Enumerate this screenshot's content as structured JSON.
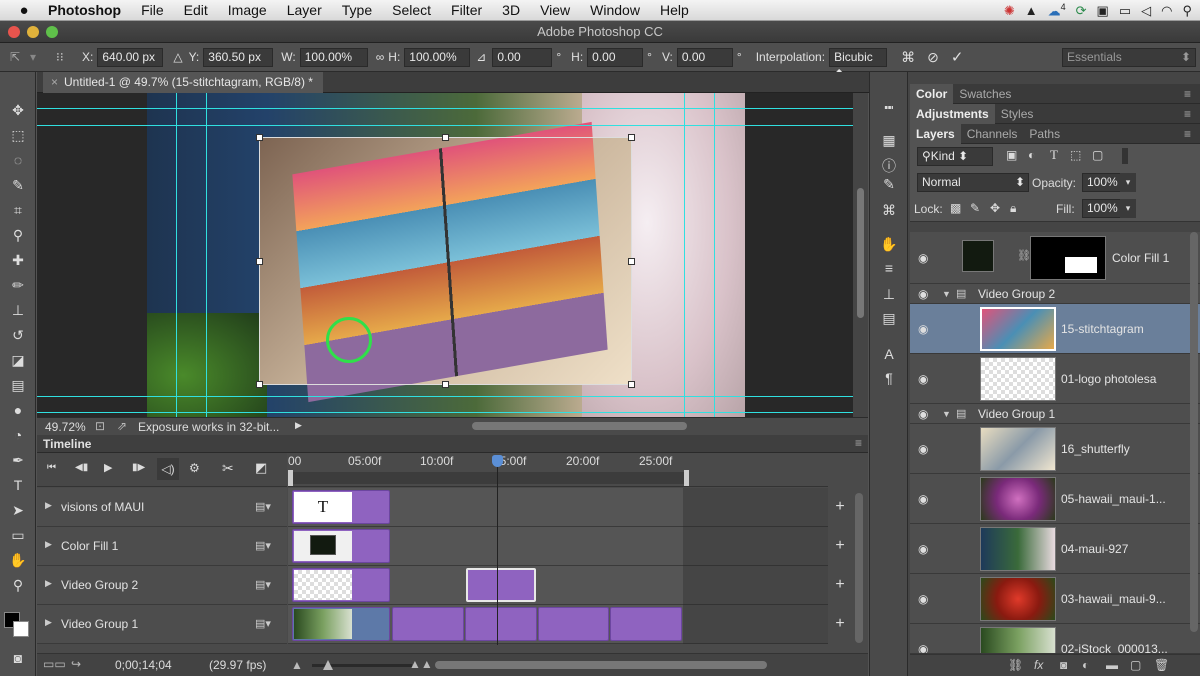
{
  "menubar": {
    "apple_icon": "apple-logo-icon",
    "app": "Photoshop",
    "items": [
      "File",
      "Edit",
      "Image",
      "Layer",
      "Type",
      "Select",
      "Filter",
      "3D",
      "View",
      "Window",
      "Help"
    ],
    "tray_badge": "4"
  },
  "window": {
    "title": "Adobe Photoshop CC"
  },
  "options": {
    "x_label": "X:",
    "x_value": "640.00 px",
    "y_label": "Y:",
    "y_value": "360.50 px",
    "w_label": "W:",
    "w_value": "100.00%",
    "h_label": "H:",
    "h_value": "100.00%",
    "angle_value": "0.00",
    "hskew_label": "H:",
    "hskew_value": "0.00",
    "vskew_label": "V:",
    "vskew_value": "0.00",
    "interp_label": "Interpolation:",
    "interp_value": "Bicubic",
    "degree": "°",
    "workspace": "Essentials"
  },
  "document": {
    "tab_title": "Untitled-1 @ 49.7% (15-stitchtagram, RGB/8) *"
  },
  "status": {
    "zoom": "49.72%",
    "message": "Exposure works in 32-bit..."
  },
  "timeline": {
    "title": "Timeline",
    "ruler": [
      "00",
      "05:00f",
      "10:00f",
      "15:00f",
      "20:00f",
      "25:00f"
    ],
    "tracks": [
      {
        "name": "visions of MAUI"
      },
      {
        "name": "Color Fill 1"
      },
      {
        "name": "Video Group 2"
      },
      {
        "name": "Video Group 1"
      }
    ],
    "timecode": "0;00;14;04",
    "fps": "(29.97 fps)",
    "text_clip_glyph": "T"
  },
  "panels": {
    "tabs_row1": [
      "Color",
      "Swatches"
    ],
    "tabs_row2": [
      "Adjustments",
      "Styles"
    ],
    "tabs_row3": [
      "Layers",
      "Channels",
      "Paths"
    ],
    "kind": "Kind",
    "blend_mode": "Normal",
    "opacity_label": "Opacity:",
    "opacity_value": "100%",
    "lock_label": "Lock:",
    "fill_label": "Fill:",
    "fill_value": "100%",
    "layers": [
      {
        "name": "Color Fill 1",
        "type": "fill"
      },
      {
        "name": "Video Group 2",
        "type": "group"
      },
      {
        "name": "15-stitchtagram",
        "type": "layer",
        "selected": true
      },
      {
        "name": "01-logo photolesa",
        "type": "layer"
      },
      {
        "name": "Video Group 1",
        "type": "group"
      },
      {
        "name": "16_shutterfly",
        "type": "layer"
      },
      {
        "name": "05-hawaii_maui-1...",
        "type": "layer"
      },
      {
        "name": "04-maui-927",
        "type": "layer"
      },
      {
        "name": "03-hawaii_maui-9...",
        "type": "layer"
      },
      {
        "name": "02-iStock_000013...",
        "type": "layer"
      }
    ]
  },
  "colors": {
    "accent_clip": "#8f63c0",
    "guide": "#30e0e0",
    "selected_layer": "#6a7f9a"
  }
}
